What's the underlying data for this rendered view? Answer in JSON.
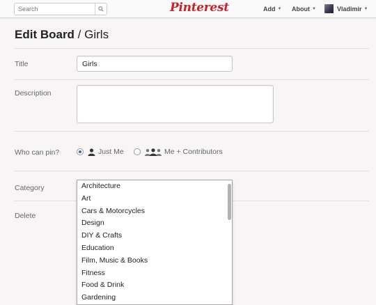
{
  "header": {
    "search_placeholder": "Search",
    "logo": "Pinterest",
    "add_label": "Add",
    "about_label": "About",
    "user_name": "Vladimir"
  },
  "page": {
    "title_main": "Edit Board",
    "title_sep": " / ",
    "title_board": "Girls"
  },
  "form": {
    "title_label": "Title",
    "title_value": "Girls",
    "description_label": "Description",
    "description_value": "",
    "who_label": "Who can pin?",
    "option_just_me": "Just Me",
    "option_contributors": "Me + Contributors",
    "selected_option": "Just Me",
    "category_label": "Category",
    "delete_label": "Delete"
  },
  "categories": [
    "Architecture",
    "Art",
    "Cars & Motorcycles",
    "Design",
    "DIY & Crafts",
    "Education",
    "Film, Music & Books",
    "Fitness",
    "Food & Drink",
    "Gardening"
  ],
  "colors": {
    "brand": "#c8232c",
    "radio_selected": "#3b6ea8"
  }
}
